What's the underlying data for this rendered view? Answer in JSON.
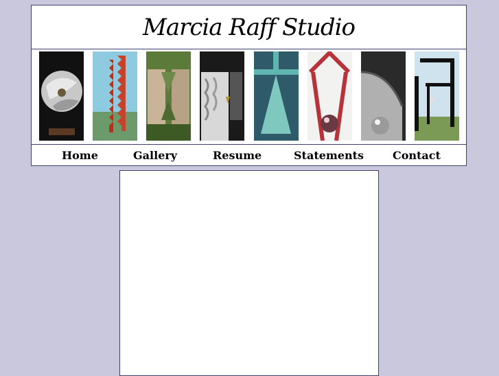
{
  "header": {
    "title": "Marcia Raff Studio"
  },
  "gallery_thumbnails": [
    {
      "name": "sculpture-silver-disc-image"
    },
    {
      "name": "sculpture-red-columns-image"
    },
    {
      "name": "sculpture-stone-arch-image"
    },
    {
      "name": "sculpture-carved-relief-image"
    },
    {
      "name": "sculpture-teal-triangle-image"
    },
    {
      "name": "sculpture-red-chevron-image"
    },
    {
      "name": "sculpture-steel-sphere-image"
    },
    {
      "name": "sculpture-black-frame-image"
    }
  ],
  "nav": {
    "home": "Home",
    "gallery": "Gallery",
    "resume": "Resume",
    "statements": "Statements",
    "contact": "Contact"
  },
  "colors": {
    "page_background": "#c9c8dc",
    "border": "#3c3f6e",
    "panel": "#ffffff"
  }
}
